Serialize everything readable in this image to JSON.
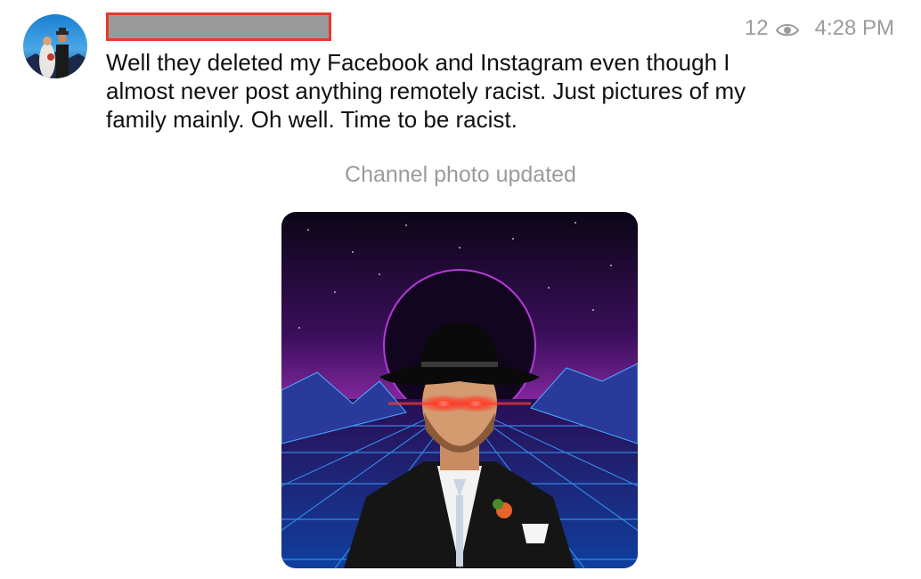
{
  "header": {
    "view_count": "12",
    "view_icon": "eye-icon",
    "time": "4:28 PM"
  },
  "message": {
    "text": "Well they deleted my Facebook and Instagram even though I almost never post anything remotely racist. Just pictures of my family mainly. Oh well. Time to be racist."
  },
  "service_message": {
    "text": "Channel photo updated"
  },
  "colors": {
    "redaction_border": "#e8392c",
    "redaction_fill": "#9a9a9a",
    "meta_text": "#9b9b9b"
  }
}
